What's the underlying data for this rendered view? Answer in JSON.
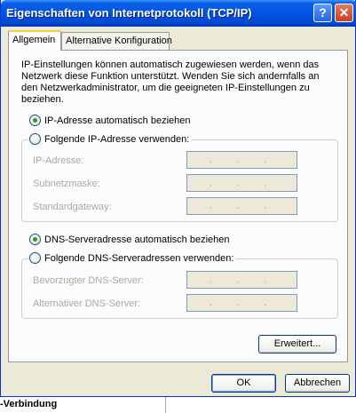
{
  "window": {
    "title": "Eigenschaften von Internetprotokoll (TCP/IP)",
    "help_label": "?",
    "close_label": "✕"
  },
  "tabs": [
    {
      "label": "Allgemein",
      "active": true
    },
    {
      "label": "Alternative Konfiguration",
      "active": false
    }
  ],
  "intro": "IP-Einstellungen können automatisch zugewiesen werden, wenn das\nNetzwerk diese Funktion unterstützt. Wenden Sie sich andernfalls an\nden Netzwerkadministrator, um die geeigneten IP-Einstellungen zu\nbeziehen.",
  "ip": {
    "auto_label": "IP-Adresse automatisch beziehen",
    "auto_selected": true,
    "manual_label": "Folgende IP-Adresse verwenden:",
    "fields": [
      {
        "label": "IP-Adresse:"
      },
      {
        "label": "Subnetzmaske:"
      },
      {
        "label": "Standardgateway:"
      }
    ]
  },
  "dns": {
    "auto_label": "DNS-Serveradresse automatisch beziehen",
    "auto_selected": true,
    "manual_label": "Folgende DNS-Serveradressen verwenden:",
    "fields": [
      {
        "label": "Bevorzugter DNS-Server:"
      },
      {
        "label": "Alternativer DNS-Server:"
      }
    ]
  },
  "field_dot": ".",
  "buttons": {
    "advanced": "Erweitert...",
    "ok": "OK",
    "cancel": "Abbrechen"
  },
  "background_text": "-Verbindung"
}
